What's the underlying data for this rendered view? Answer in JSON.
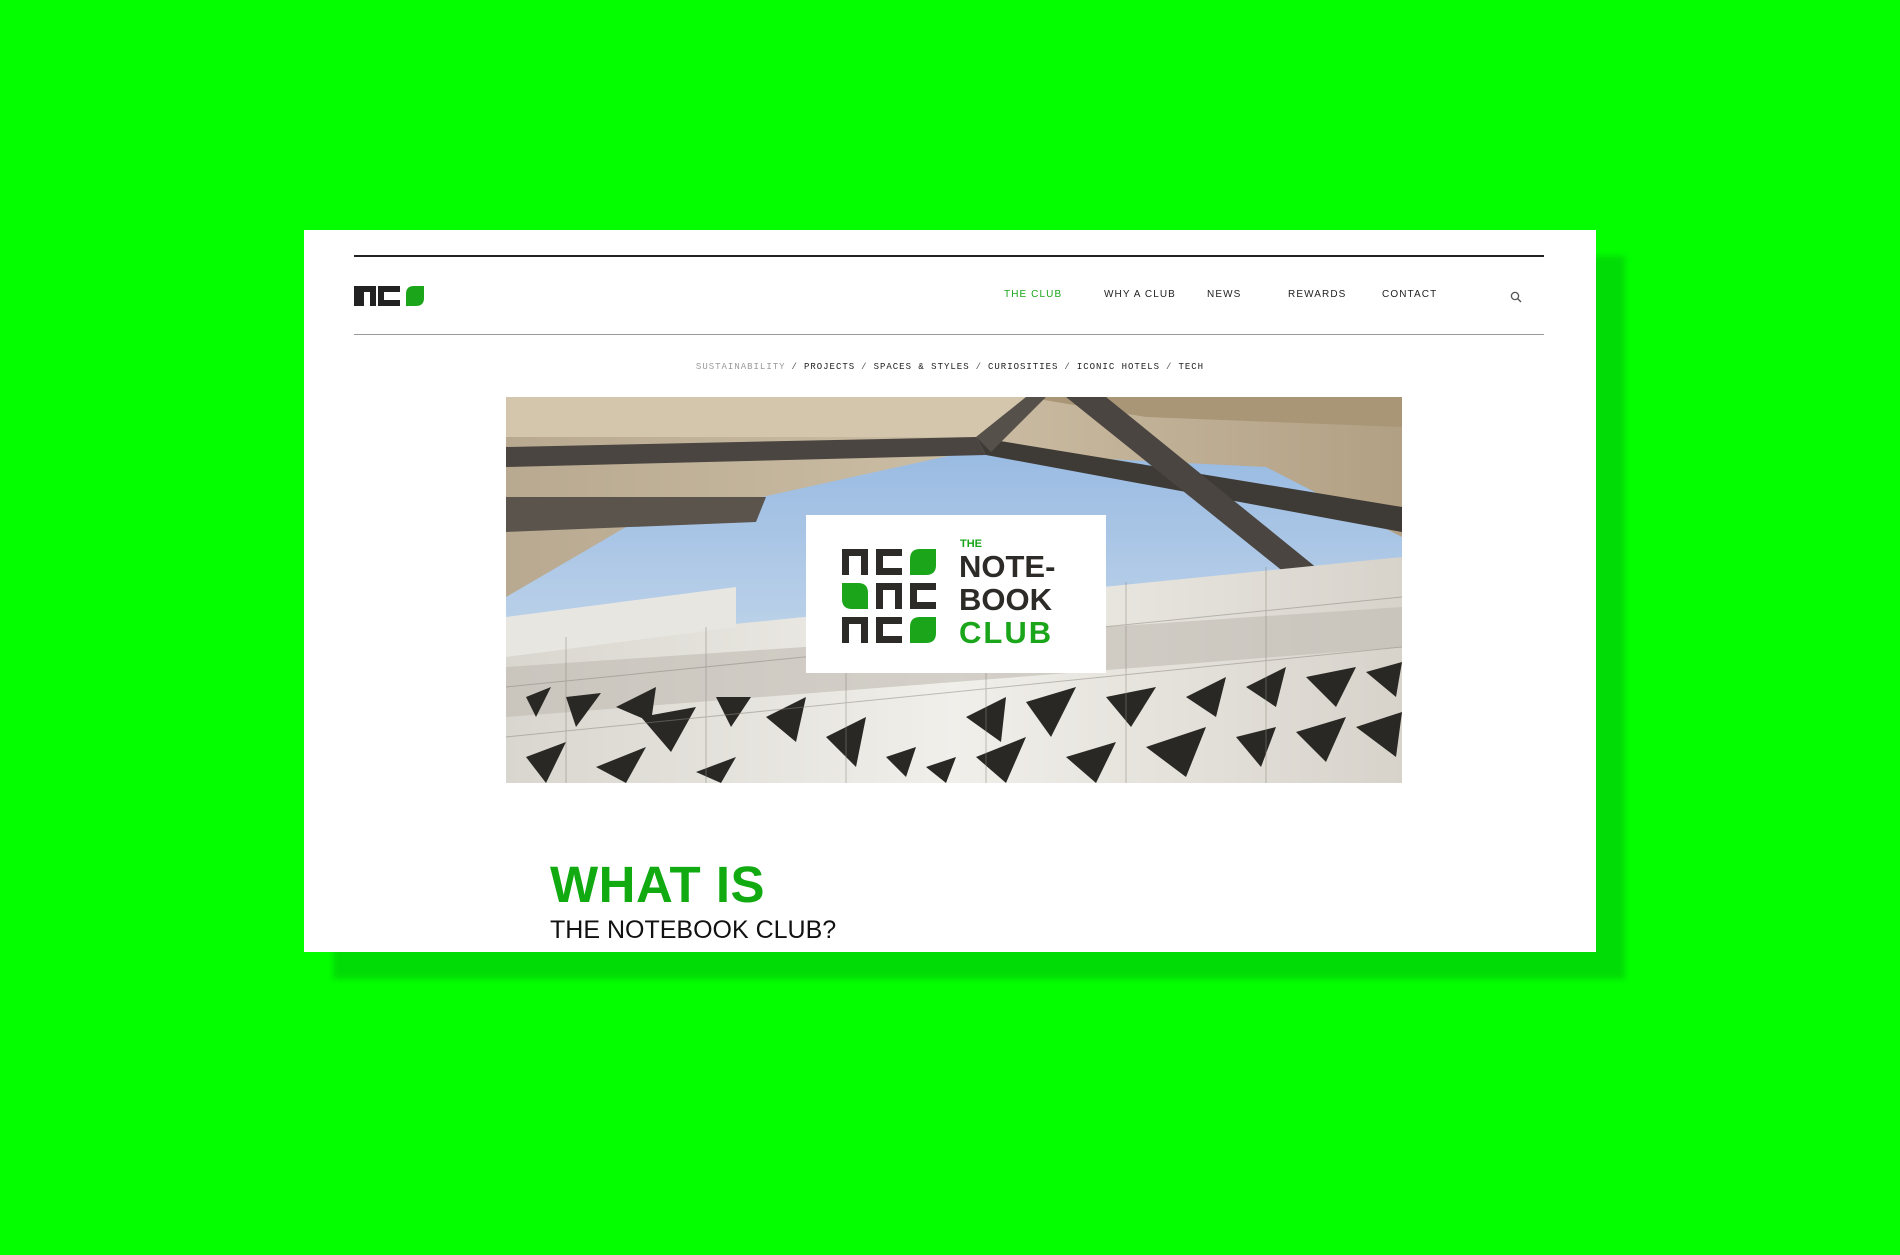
{
  "header": {
    "logo_text": "nc"
  },
  "nav": {
    "items": [
      {
        "label": "THE CLUB",
        "active": true
      },
      {
        "label": "WHY A CLUB",
        "active": false
      },
      {
        "label": "NEWS",
        "active": false
      },
      {
        "label": "REWARDS",
        "active": false
      },
      {
        "label": "CONTACT",
        "active": false
      }
    ],
    "search_icon": "search-icon"
  },
  "categories": [
    {
      "label": "SUSTAINABILITY",
      "muted": true
    },
    {
      "label": "PROJECTS",
      "muted": false
    },
    {
      "label": "SPACES & STYLES",
      "muted": false
    },
    {
      "label": "CURIOSITIES",
      "muted": false
    },
    {
      "label": "ICONIC HOTELS",
      "muted": false
    },
    {
      "label": "TECH",
      "muted": false
    }
  ],
  "hero": {
    "card_the": "THE",
    "card_line1": "NOTE-",
    "card_line2": "BOOK",
    "card_line3": "CLUB"
  },
  "intro": {
    "headline": "WHAT IS",
    "subheadline": "THE NOTEBOOK CLUB?"
  },
  "colors": {
    "background": "#04fe00",
    "brand_green": "#1aa51a",
    "dark": "#222222"
  }
}
